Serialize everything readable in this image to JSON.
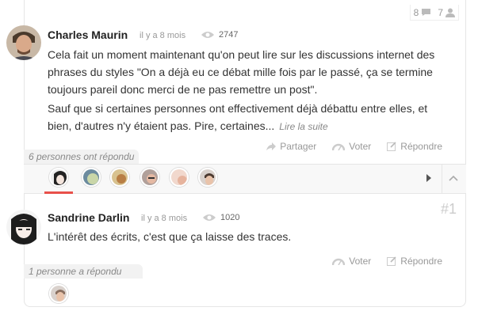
{
  "top_stats": {
    "comments": "8",
    "users": "7"
  },
  "post": {
    "author": "Charles Maurin",
    "time": "il y a 8 mois",
    "views": "2747",
    "paragraph1": "Cela fait un moment maintenant qu'on peut lire sur les discussions internet des phrases du styles \"On a déjà eu ce débat mille fois par le passé, ça se termine toujours pareil donc merci de ne pas remettre un post\".",
    "paragraph2": "Sauf que si certaines personnes ont effectivement déjà débattu entre elles, et bien, d'autres n'y étaient pas. Pire, certaines...",
    "read_more": "Lire la suite",
    "actions": {
      "share": "Partager",
      "vote": "Voter",
      "reply": "Répondre"
    },
    "replied_count": "6 personnes ont répondu"
  },
  "reply": {
    "author": "Sandrine Darlin",
    "time": "il y a 8 mois",
    "views": "1020",
    "rank": "#1",
    "text": "L'intérêt des écrits, c'est que ça laisse des traces.",
    "actions": {
      "vote": "Voter",
      "reply": "Répondre"
    },
    "replied_count": "1 personne a répondu"
  },
  "colors": {
    "accent": "#e8504a",
    "muted": "#999999"
  }
}
